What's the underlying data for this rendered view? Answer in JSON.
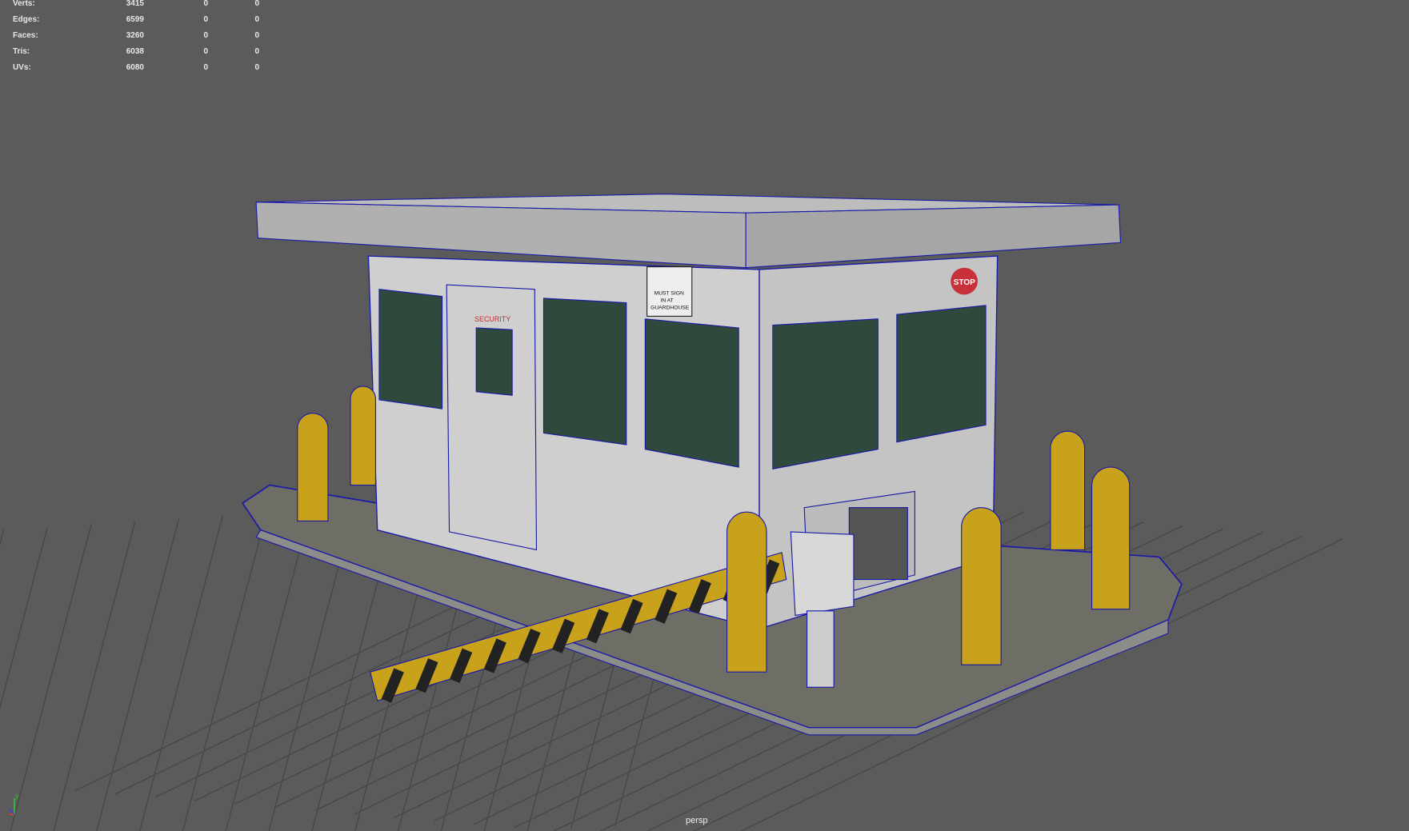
{
  "hud": {
    "rows": [
      {
        "label": "Verts:",
        "value": "3415",
        "sel": "0",
        "uv": "0"
      },
      {
        "label": "Edges:",
        "value": "6599",
        "sel": "0",
        "uv": "0"
      },
      {
        "label": "Faces:",
        "value": "3260",
        "sel": "0",
        "uv": "0"
      },
      {
        "label": "Tris:",
        "value": "6038",
        "sel": "0",
        "uv": "0"
      },
      {
        "label": "UVs:",
        "value": "6080",
        "sel": "0",
        "uv": "0"
      }
    ]
  },
  "camera": "persp",
  "axis": {
    "y_label": "y"
  },
  "scene": {
    "door_sign": "SECURITY",
    "stop_sign": "STOP",
    "notice_lines": [
      "MUST SIGN",
      "IN AT",
      "GUARDHOUSE"
    ],
    "colors": {
      "background": "#5b5b5b",
      "grid": "#474747",
      "wire": "#1a1aa8",
      "bollard": "#c9a21c",
      "glass": "#2f4a3c",
      "wall": "#cfcfcf"
    }
  }
}
